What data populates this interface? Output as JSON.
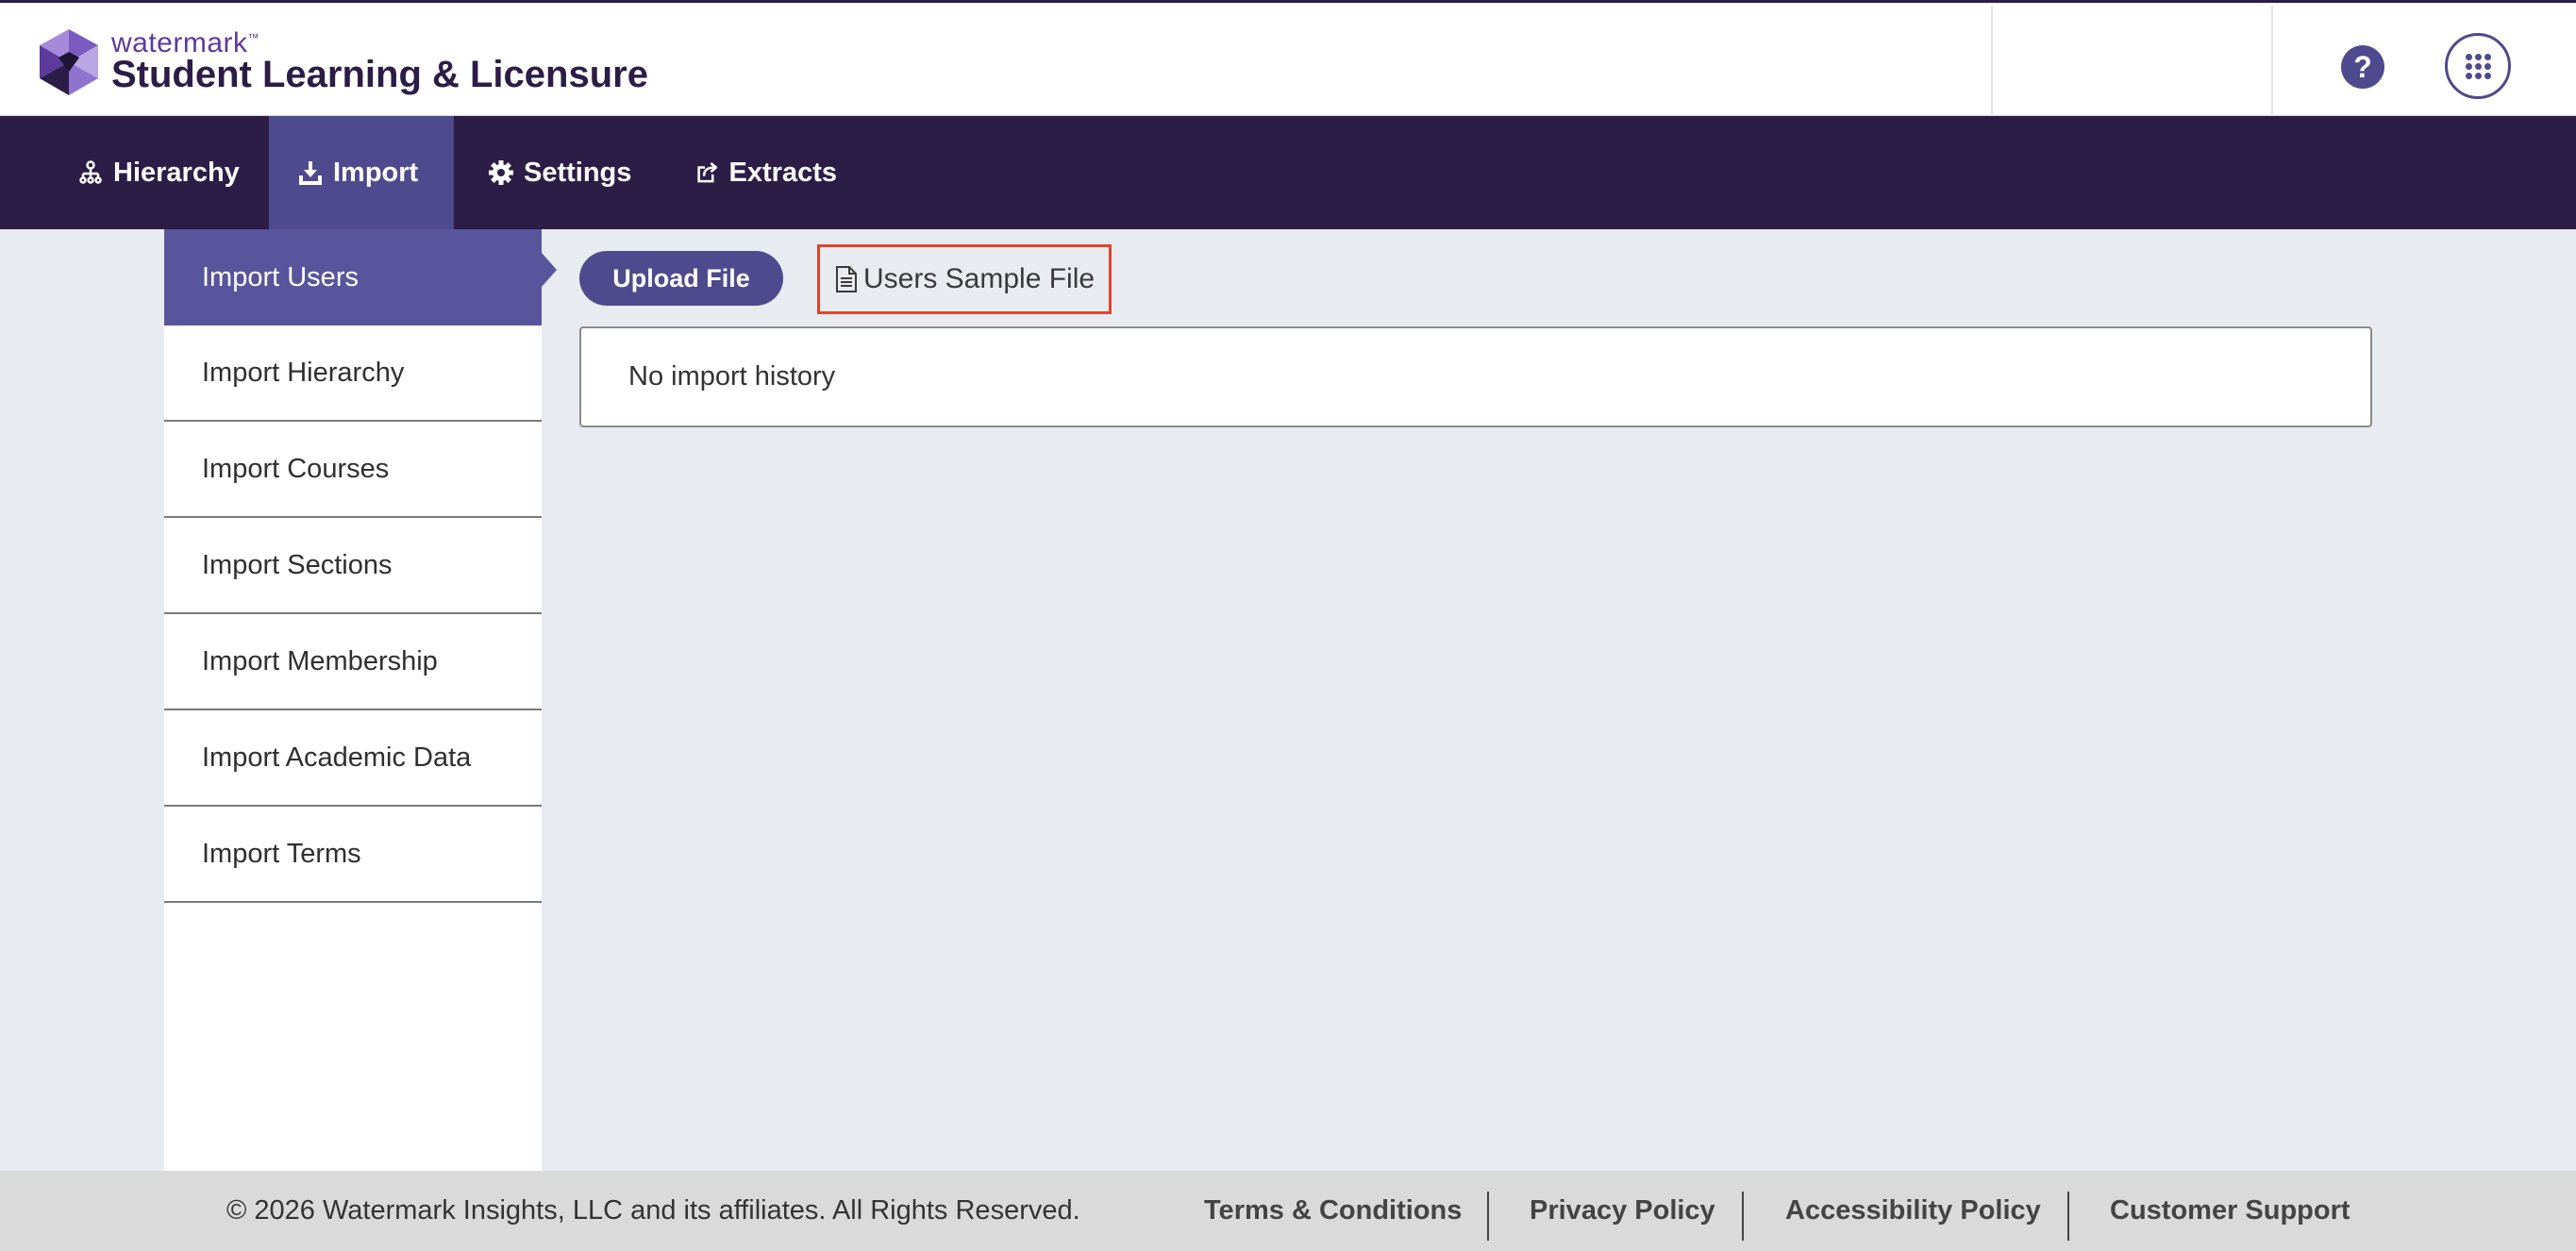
{
  "header": {
    "brand_small": "watermark",
    "brand_tm": "™",
    "product_name": "Student Learning & Licensure",
    "help_label": "?"
  },
  "nav": {
    "items": [
      {
        "label": "Hierarchy",
        "icon": "hierarchy-icon"
      },
      {
        "label": "Import",
        "icon": "import-icon",
        "active": true
      },
      {
        "label": "Settings",
        "icon": "gear-icon"
      },
      {
        "label": "Extracts",
        "icon": "external-link-icon"
      }
    ]
  },
  "sidebar": {
    "items": [
      {
        "label": "Import Users",
        "active": true
      },
      {
        "label": "Import Hierarchy"
      },
      {
        "label": "Import Courses"
      },
      {
        "label": "Import Sections"
      },
      {
        "label": "Import Membership"
      },
      {
        "label": "Import Academic Data"
      },
      {
        "label": "Import Terms"
      }
    ]
  },
  "main": {
    "upload_label": "Upload File",
    "sample_file_label": "Users Sample File",
    "history_empty": "No import history"
  },
  "footer": {
    "copyright": "© 2026 Watermark Insights, LLC and its affiliates. All Rights Reserved.",
    "links": [
      "Terms & Conditions",
      "Privacy Policy",
      "Accessibility Policy",
      "Customer Support"
    ]
  },
  "colors": {
    "nav_bg": "#2c1d47",
    "accent": "#4f4a8d",
    "sidebar_active": "#59559c",
    "highlight_border": "#e0452b"
  }
}
